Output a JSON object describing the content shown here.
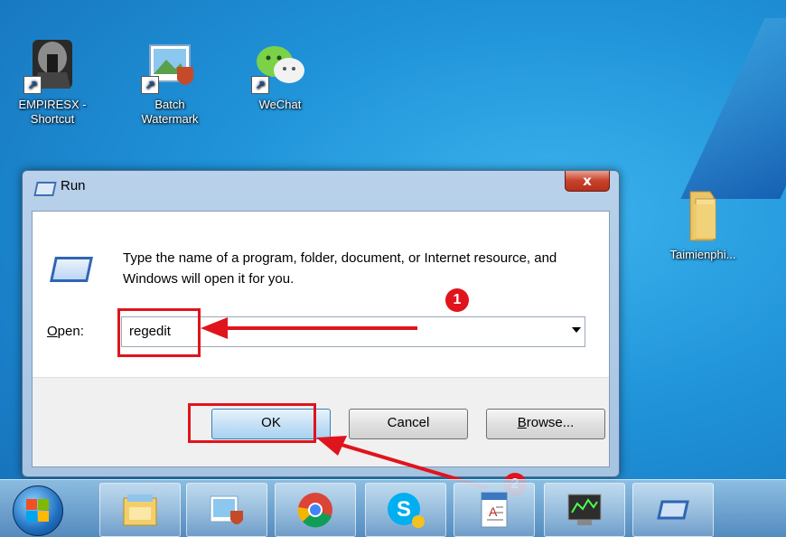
{
  "desktop": {
    "icons": [
      {
        "label_line1": "EMPIRESX -",
        "label_line2": "Shortcut",
        "icon": "empiresx-icon"
      },
      {
        "label_line1": "Batch",
        "label_line2": "Watermark",
        "icon": "batch-watermark-icon"
      },
      {
        "label_line1": "WeChat",
        "label_line2": "",
        "icon": "wechat-icon"
      },
      {
        "label_line1": "Taimienphi...",
        "label_line2": "",
        "icon": "folder-icon"
      }
    ]
  },
  "run_dialog": {
    "title": "Run",
    "close_glyph": "x",
    "description": "Type the name of a program, folder, document, or Internet resource, and Windows will open it for you.",
    "open_label": "Open:",
    "open_value": "regedit",
    "buttons": {
      "ok": "OK",
      "cancel": "Cancel",
      "browse": "Browse..."
    }
  },
  "annotations": {
    "step1": "1",
    "step2": "2",
    "color": "#e0141c"
  },
  "taskbar": {
    "items": [
      "windows-explorer-icon",
      "batch-watermark-icon",
      "chrome-icon",
      "skype-icon",
      "wordpad-icon",
      "task-manager-icon",
      "run-icon"
    ]
  }
}
